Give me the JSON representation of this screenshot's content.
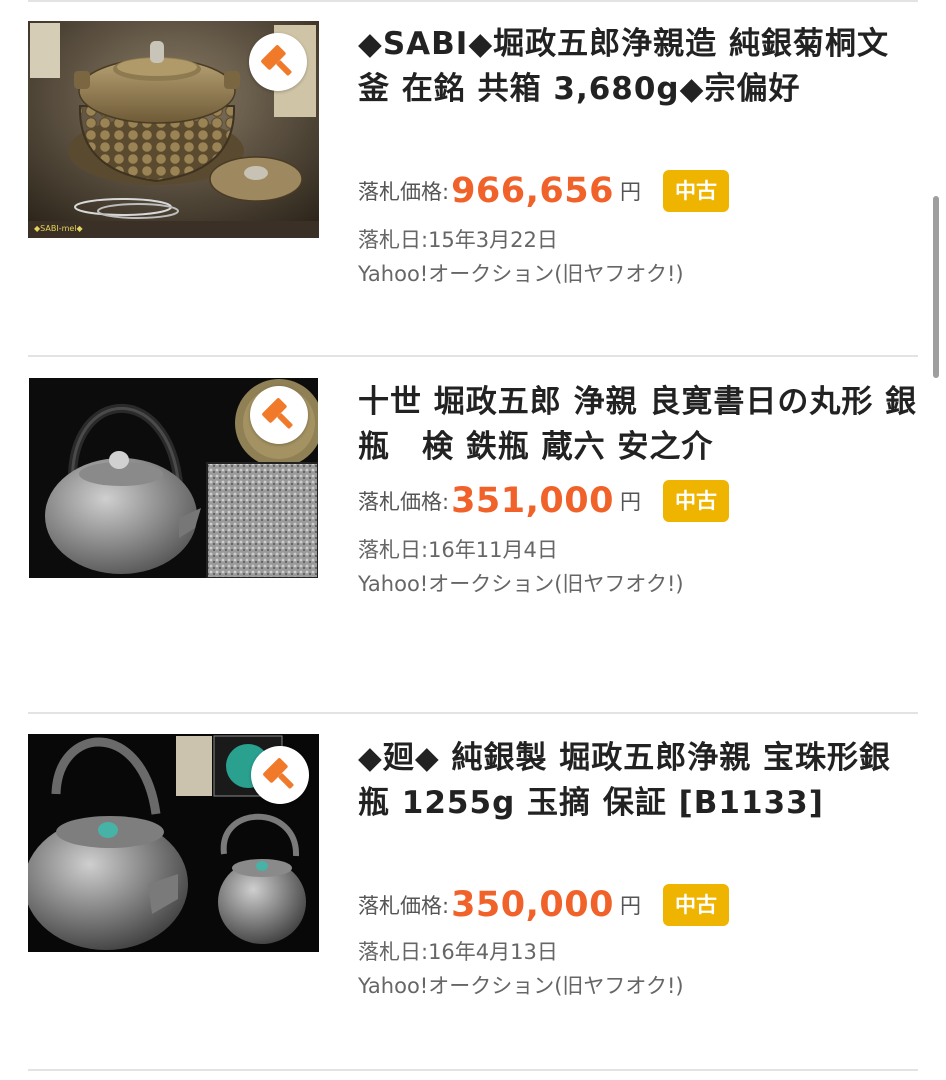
{
  "labels": {
    "price_label": "落札価格:",
    "price_unit": "円"
  },
  "results": [
    {
      "title": "◆SABI◆堀政五郎浄親造 純銀菊桐文釜 在銘 共箱 3,680g◆宗偏好",
      "price": "966,656",
      "condition": "中古",
      "date": "落札日:15年3月22日",
      "source": "Yahoo!オークション(旧ヤフオク!)",
      "thumb_caption": "◆SABI-mel◆"
    },
    {
      "title": "十世 堀政五郎 浄親 良寛書日の丸形 銀瓶　検 鉄瓶 蔵六 安之介",
      "price": "351,000",
      "condition": "中古",
      "date": "落札日:16年11月4日",
      "source": "Yahoo!オークション(旧ヤフオク!)"
    },
    {
      "title": "◆廻◆ 純銀製 堀政五郎浄親 宝珠形銀瓶 1255g 玉摘 保証 [B1133]",
      "price": "350,000",
      "condition": "中古",
      "date": "落札日:16年4月13日",
      "source": "Yahoo!オークション(旧ヤフオク!)"
    }
  ],
  "colors": {
    "price": "#f0622a",
    "condition_badge": "#efb400",
    "auction_icon": "#f07a2a"
  },
  "icons": {
    "auction": "auction-gavel-icon"
  }
}
